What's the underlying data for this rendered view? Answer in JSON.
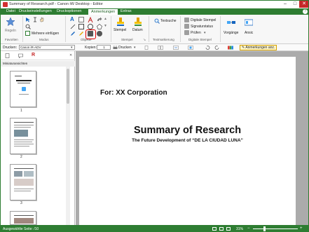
{
  "window": {
    "title": "Summary of Research.pdf - Canon iW Desktop - Editor",
    "controls": [
      "–",
      "□",
      "✕"
    ]
  },
  "menubar": {
    "tabs": [
      "Datei",
      "Druckeinstellungen",
      "Druckoptionen",
      "Anmerkungen",
      "Extras"
    ],
    "active_tab": "Anmerkungen",
    "help": "?"
  },
  "ribbon": {
    "favorites": {
      "button": "Regeln",
      "group": "Favoriten"
    },
    "mode": {
      "multi": "Mehrere einfügen",
      "group": "Modus"
    },
    "objects": {
      "group": "Objekte"
    },
    "stamps": {
      "stamp": "Stempel",
      "date": "Datum",
      "group": "Stempel"
    },
    "textmark": {
      "search": "Textsuche",
      "group": "Textmarkierung"
    },
    "digital": {
      "digital": "Digitale Stempel",
      "signature": "Signaturstatus",
      "verify": "Prüfen",
      "group": "Digitale Stempel"
    },
    "view": {
      "process": "Vorgänge",
      "display": "Ansic"
    }
  },
  "toolbar2": {
    "printer_label": "Drucken:",
    "printer_value": "Canon iR-ADV",
    "copies_label": "Kopien:",
    "copies_value": "1",
    "print_button": "Drucken",
    "annotations_button": "Anmerkungen anz."
  },
  "sidebar": {
    "header": "Miniaturansichten",
    "pages": [
      "1",
      "2",
      "3"
    ]
  },
  "document": {
    "for_line": "For: XX Corporation",
    "title": "Summary of Research",
    "subtitle": "The Future Development of “DE LA CIUDAD LUNA”"
  },
  "status": {
    "selected": "Ausgewählte Seite: /10",
    "zoom": "31%"
  }
}
